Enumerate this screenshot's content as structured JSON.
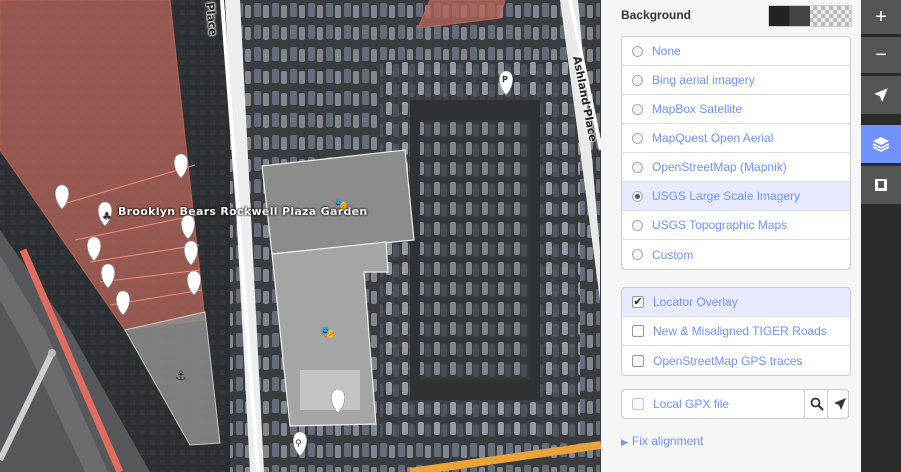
{
  "map": {
    "poi_label": "Brooklyn Bears Rockwell Plaza Garden",
    "street_1": "Place",
    "street_2": "Ashland Place",
    "parking_letter": "P"
  },
  "background_panel": {
    "title": "Background",
    "imagery": [
      {
        "label": "None",
        "selected": false
      },
      {
        "label": "Bing aerial imagery",
        "selected": false
      },
      {
        "label": "MapBox Satellite",
        "selected": false
      },
      {
        "label": "MapQuest Open Aerial",
        "selected": false
      },
      {
        "label": "OpenStreetMap (Mapnik)",
        "selected": false
      },
      {
        "label": "USGS Large Scale Imagery",
        "selected": true
      },
      {
        "label": "USGS Topographic Maps",
        "selected": false
      },
      {
        "label": "Custom",
        "selected": false
      }
    ],
    "overlays": [
      {
        "label": "Locator Overlay",
        "checked": true
      },
      {
        "label": "New & Misaligned TIGER Roads",
        "checked": false
      },
      {
        "label": "OpenStreetMap GPS traces",
        "checked": false
      }
    ],
    "gpx_label": "Local GPX file",
    "fix_alignment": "Fix alignment",
    "accent_color": "#7092ff"
  },
  "toolbar": {
    "zoom_in": "+",
    "zoom_out": "−",
    "icons": [
      "plus-icon",
      "minus-icon",
      "locate-arrow-icon",
      "layers-icon",
      "map-data-icon"
    ]
  }
}
